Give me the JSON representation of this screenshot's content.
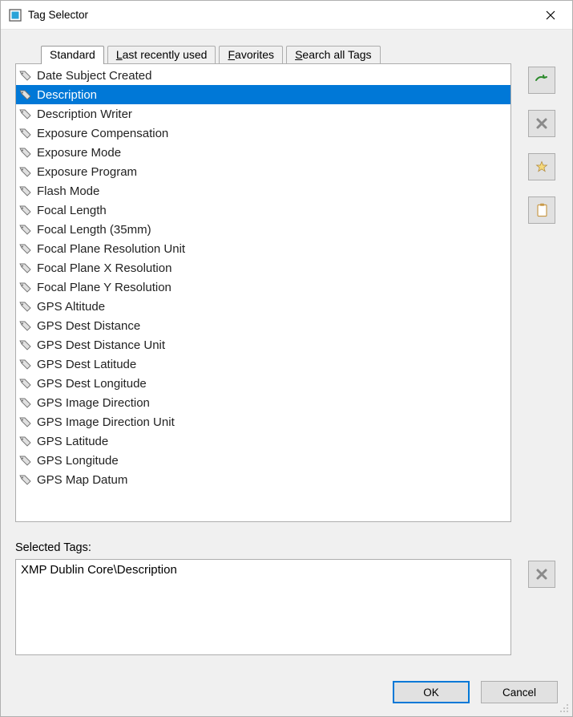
{
  "window": {
    "title": "Tag Selector"
  },
  "tabs": [
    {
      "label": "Standard",
      "mnemonic_index": null,
      "active": true
    },
    {
      "label": "Last recently used",
      "mnemonic_index": 0,
      "active": false
    },
    {
      "label": "Favorites",
      "mnemonic_index": 0,
      "active": false
    },
    {
      "label": "Search all Tags",
      "mnemonic_index": 0,
      "active": false
    }
  ],
  "list": {
    "items": [
      "Date Subject Created",
      "Description",
      "Description Writer",
      "Exposure Compensation",
      "Exposure Mode",
      "Exposure Program",
      "Flash Mode",
      "Focal Length",
      "Focal Length (35mm)",
      "Focal Plane Resolution Unit",
      "Focal Plane X Resolution",
      "Focal Plane Y Resolution",
      "GPS Altitude",
      "GPS Dest Distance",
      "GPS Dest Distance Unit",
      "GPS Dest Latitude",
      "GPS Dest Longitude",
      "GPS Image Direction",
      "GPS Image Direction Unit",
      "GPS Latitude",
      "GPS Longitude",
      "GPS Map Datum"
    ],
    "selected_index": 1
  },
  "side_buttons": {
    "add": "add",
    "remove": "remove",
    "favorite": "favorite",
    "clipboard": "clipboard"
  },
  "selected_tags": {
    "label": "Selected Tags:",
    "value": "XMP Dublin Core\\Description"
  },
  "footer": {
    "ok": "OK",
    "cancel": "Cancel"
  }
}
